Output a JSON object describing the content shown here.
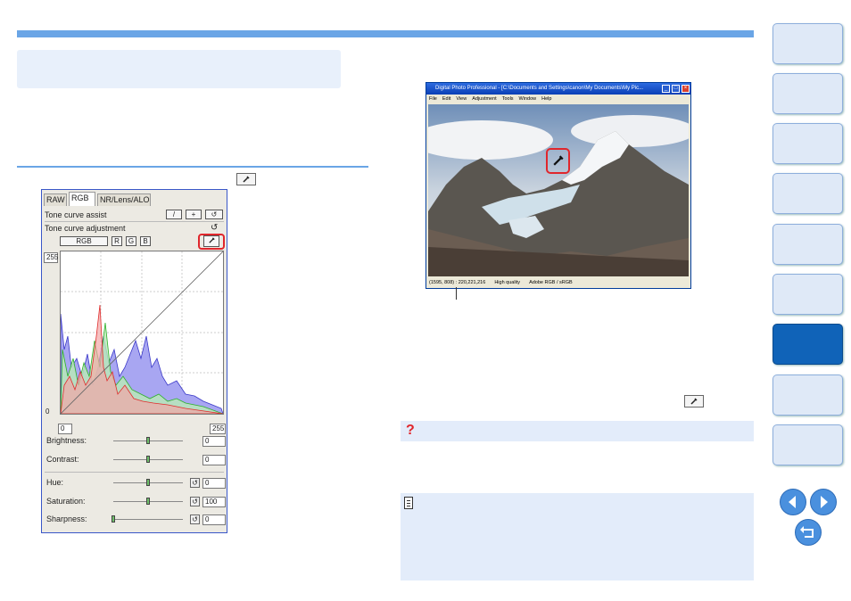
{
  "panel": {
    "tabs": [
      "RAW",
      "RGB",
      "NR/Lens/ALO"
    ],
    "tone_curve_assist": "Tone curve assist",
    "tone_curve_adjustment": "Tone curve adjustment",
    "channel_buttons": [
      "RGB",
      "R",
      "G",
      "B"
    ],
    "graph_max": "255",
    "graph_min": "0",
    "input_min": "0",
    "input_max": "255",
    "sliders": [
      {
        "label": "Brightness:",
        "value": "0",
        "level": 0.5
      },
      {
        "label": "Contrast:",
        "value": "0",
        "level": 0.5
      },
      {
        "label": "Hue:",
        "value": "0",
        "level": 0.5
      },
      {
        "label": "Saturation:",
        "value": "100",
        "level": 0.5
      },
      {
        "label": "Sharpness:",
        "value": "0",
        "level": 0.0
      }
    ]
  },
  "window": {
    "title": "Digital Photo Professional - [C:\\Documents and Settings\\canon\\My Documents\\My Pic...",
    "menu": [
      "File",
      "Edit",
      "View",
      "Adjustment",
      "Tools",
      "Window",
      "Help"
    ],
    "status": [
      "(1595, 808) : 220,221,216",
      "High quality",
      "Adobe RGB / sRGB"
    ]
  },
  "help_mark": "?",
  "icons": {
    "eyedropper": "eyedropper-icon",
    "note": "memo-icon",
    "prev": "arrow-left-icon",
    "next": "arrow-right-icon",
    "back": "return-icon"
  },
  "colors": {
    "accent": "#6aa5e6",
    "highlight": "#e0262c",
    "active_nav": "#1063b8"
  }
}
